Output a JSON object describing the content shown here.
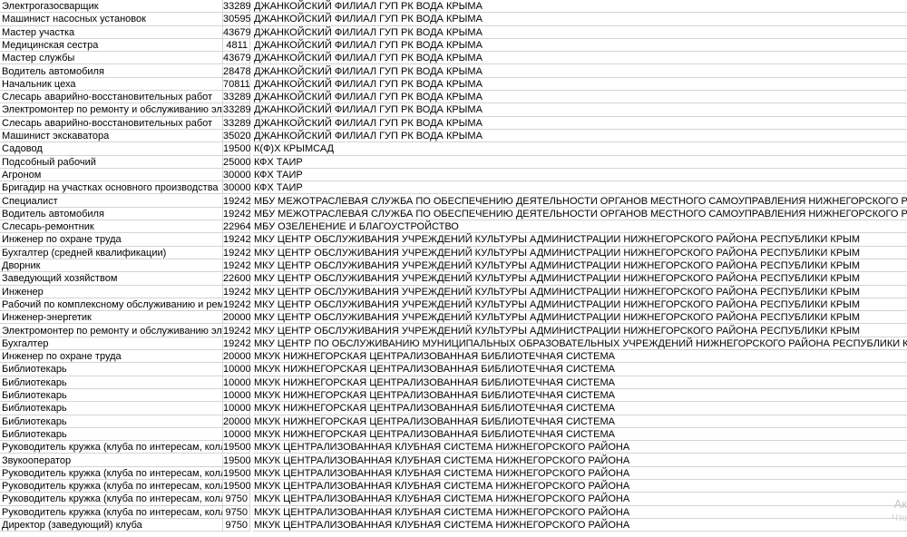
{
  "sheet": {
    "rows": [
      {
        "position": "Электрогазосварщик",
        "salary": "33289",
        "employer": "ДЖАНКОЙСКИЙ ФИЛИАЛ ГУП РК ВОДА КРЫМА"
      },
      {
        "position": "Машинист насосных установок",
        "salary": "30595",
        "employer": "ДЖАНКОЙСКИЙ ФИЛИАЛ ГУП РК ВОДА КРЫМА"
      },
      {
        "position": "Мастер участка",
        "salary": "43679",
        "employer": "ДЖАНКОЙСКИЙ ФИЛИАЛ ГУП РК ВОДА КРЫМА"
      },
      {
        "position": "Медицинская сестра",
        "salary": "4811",
        "employer": "ДЖАНКОЙСКИЙ ФИЛИАЛ ГУП РК ВОДА КРЫМА"
      },
      {
        "position": "Мастер службы",
        "salary": "43679",
        "employer": "ДЖАНКОЙСКИЙ ФИЛИАЛ ГУП РК ВОДА КРЫМА"
      },
      {
        "position": "Водитель автомобиля",
        "salary": "28478",
        "employer": "ДЖАНКОЙСКИЙ ФИЛИАЛ ГУП РК ВОДА КРЫМА"
      },
      {
        "position": "Начальник цеха",
        "salary": "70811",
        "employer": "ДЖАНКОЙСКИЙ ФИЛИАЛ ГУП РК ВОДА КРЫМА"
      },
      {
        "position": "Слесарь аварийно-восстановительных работ",
        "salary": "33289",
        "employer": "ДЖАНКОЙСКИЙ ФИЛИАЛ ГУП РК ВОДА КРЫМА"
      },
      {
        "position": "Электромонтер по ремонту и обслуживанию электрооборудования",
        "salary": "33289",
        "employer": "ДЖАНКОЙСКИЙ ФИЛИАЛ ГУП РК ВОДА КРЫМА"
      },
      {
        "position": "Слесарь аварийно-восстановительных работ",
        "salary": "33289",
        "employer": "ДЖАНКОЙСКИЙ ФИЛИАЛ ГУП РК ВОДА КРЫМА"
      },
      {
        "position": "Машинист экскаватора",
        "salary": "35020",
        "employer": "ДЖАНКОЙСКИЙ ФИЛИАЛ ГУП РК ВОДА КРЫМА"
      },
      {
        "position": "Садовод",
        "salary": "19500",
        "employer": "К(Ф)Х КРЫМСАД"
      },
      {
        "position": "Подсобный рабочий",
        "salary": "25000",
        "employer": "КФХ ТАИР"
      },
      {
        "position": "Агроном",
        "salary": "30000",
        "employer": "КФХ ТАИР"
      },
      {
        "position": "Бригадир на участках основного производства",
        "salary": "30000",
        "employer": "КФХ ТАИР"
      },
      {
        "position": "Специалист",
        "salary": "19242",
        "employer": "МБУ МЕЖОТРАСЛЕВАЯ СЛУЖБА ПО ОБЕСПЕЧЕНИЮ ДЕЯТЕЛЬНОСТИ ОРГАНОВ МЕСТНОГО САМОУПРАВЛЕНИЯ НИЖНЕГОРСКОГО РАЙОНА РЕСПУБЛИКИ КРЫМ"
      },
      {
        "position": "Водитель автомобиля",
        "salary": "19242",
        "employer": "МБУ МЕЖОТРАСЛЕВАЯ СЛУЖБА ПО ОБЕСПЕЧЕНИЮ ДЕЯТЕЛЬНОСТИ ОРГАНОВ МЕСТНОГО САМОУПРАВЛЕНИЯ НИЖНЕГОРСКОГО РАЙОНА РЕСПУБЛИКИ КРЫМ"
      },
      {
        "position": "Слесарь-ремонтник",
        "salary": "22964",
        "employer": "МБУ ОЗЕЛЕНЕНИЕ И БЛАГОУСТРОЙСТВО"
      },
      {
        "position": "Инженер по охране труда",
        "salary": "19242",
        "employer": "МКУ ЦЕНТР ОБСЛУЖИВАНИЯ УЧРЕЖДЕНИЙ КУЛЬТУРЫ АДМИНИСТРАЦИИ НИЖНЕГОРСКОГО РАЙОНА  РЕСПУБЛИКИ КРЫМ"
      },
      {
        "position": "Бухгалтер (средней квалификации)",
        "salary": "19242",
        "employer": "МКУ ЦЕНТР ОБСЛУЖИВАНИЯ УЧРЕЖДЕНИЙ КУЛЬТУРЫ АДМИНИСТРАЦИИ НИЖНЕГОРСКОГО РАЙОНА  РЕСПУБЛИКИ КРЫМ"
      },
      {
        "position": "Дворник",
        "salary": "19242",
        "employer": "МКУ ЦЕНТР ОБСЛУЖИВАНИЯ УЧРЕЖДЕНИЙ КУЛЬТУРЫ АДМИНИСТРАЦИИ НИЖНЕГОРСКОГО РАЙОНА  РЕСПУБЛИКИ КРЫМ"
      },
      {
        "position": "Заведующий хозяйством",
        "salary": "22600",
        "employer": "МКУ ЦЕНТР ОБСЛУЖИВАНИЯ УЧРЕЖДЕНИЙ КУЛЬТУРЫ АДМИНИСТРАЦИИ НИЖНЕГОРСКОГО РАЙОНА  РЕСПУБЛИКИ КРЫМ"
      },
      {
        "position": "Инженер",
        "salary": "19242",
        "employer": "МКУ ЦЕНТР ОБСЛУЖИВАНИЯ УЧРЕЖДЕНИЙ КУЛЬТУРЫ АДМИНИСТРАЦИИ НИЖНЕГОРСКОГО РАЙОНА  РЕСПУБЛИКИ КРЫМ"
      },
      {
        "position": "Рабочий по комплексному обслуживанию и ремонту зданий",
        "salary": "19242",
        "employer": "МКУ ЦЕНТР ОБСЛУЖИВАНИЯ УЧРЕЖДЕНИЙ КУЛЬТУРЫ АДМИНИСТРАЦИИ НИЖНЕГОРСКОГО РАЙОНА  РЕСПУБЛИКИ КРЫМ"
      },
      {
        "position": "Инженер-энергетик",
        "salary": "20000",
        "employer": "МКУ ЦЕНТР ОБСЛУЖИВАНИЯ УЧРЕЖДЕНИЙ КУЛЬТУРЫ АДМИНИСТРАЦИИ НИЖНЕГОРСКОГО РАЙОНА  РЕСПУБЛИКИ КРЫМ"
      },
      {
        "position": "Электромонтер по ремонту и обслуживанию электрооборудования",
        "salary": "19242",
        "employer": "МКУ ЦЕНТР ОБСЛУЖИВАНИЯ УЧРЕЖДЕНИЙ КУЛЬТУРЫ АДМИНИСТРАЦИИ НИЖНЕГОРСКОГО РАЙОНА  РЕСПУБЛИКИ КРЫМ"
      },
      {
        "position": "Бухгалтер",
        "salary": "19242",
        "employer": "МКУ ЦЕНТР ПО ОБСЛУЖИВАНИЮ МУНИЦИПАЛЬНЫХ ОБРАЗОВАТЕЛЬНЫХ УЧРЕЖДЕНИЙ НИЖНЕГОРСКОГО РАЙОНА РЕСПУБЛИКИ КРЫМ"
      },
      {
        "position": "Инженер по охране труда",
        "salary": "20000",
        "employer": "МКУК НИЖНЕГОРСКАЯ ЦЕНТРАЛИЗОВАННАЯ БИБЛИОТЕЧНАЯ СИСТЕМА"
      },
      {
        "position": "Библиотекарь",
        "salary": "10000",
        "employer": "МКУК НИЖНЕГОРСКАЯ ЦЕНТРАЛИЗОВАННАЯ БИБЛИОТЕЧНАЯ СИСТЕМА"
      },
      {
        "position": "Библиотекарь",
        "salary": "10000",
        "employer": "МКУК НИЖНЕГОРСКАЯ ЦЕНТРАЛИЗОВАННАЯ БИБЛИОТЕЧНАЯ СИСТЕМА"
      },
      {
        "position": "Библиотекарь",
        "salary": "10000",
        "employer": "МКУК НИЖНЕГОРСКАЯ ЦЕНТРАЛИЗОВАННАЯ БИБЛИОТЕЧНАЯ СИСТЕМА"
      },
      {
        "position": "Библиотекарь",
        "salary": "10000",
        "employer": "МКУК НИЖНЕГОРСКАЯ ЦЕНТРАЛИЗОВАННАЯ БИБЛИОТЕЧНАЯ СИСТЕМА"
      },
      {
        "position": "Библиотекарь",
        "salary": "20000",
        "employer": "МКУК НИЖНЕГОРСКАЯ ЦЕНТРАЛИЗОВАННАЯ БИБЛИОТЕЧНАЯ СИСТЕМА"
      },
      {
        "position": "Библиотекарь",
        "salary": "10000",
        "employer": "МКУК НИЖНЕГОРСКАЯ ЦЕНТРАЛИЗОВАННАЯ БИБЛИОТЕЧНАЯ СИСТЕМА"
      },
      {
        "position": "Руководитель кружка (клуба по интересам, коллектива)",
        "salary": "19500",
        "employer": "МКУК ЦЕНТРАЛИЗОВАННАЯ КЛУБНАЯ СИСТЕМА НИЖНЕГОРСКОГО РАЙОНА"
      },
      {
        "position": "Звукооператор",
        "salary": "19500",
        "employer": "МКУК ЦЕНТРАЛИЗОВАННАЯ КЛУБНАЯ СИСТЕМА НИЖНЕГОРСКОГО РАЙОНА"
      },
      {
        "position": "Руководитель кружка (клуба по интересам, коллектива)",
        "salary": "19500",
        "employer": "МКУК ЦЕНТРАЛИЗОВАННАЯ КЛУБНАЯ СИСТЕМА НИЖНЕГОРСКОГО РАЙОНА"
      },
      {
        "position": "Руководитель кружка (клуба по интересам, коллектива)",
        "salary": "19500",
        "employer": "МКУК ЦЕНТРАЛИЗОВАННАЯ КЛУБНАЯ СИСТЕМА НИЖНЕГОРСКОГО РАЙОНА"
      },
      {
        "position": "Руководитель кружка (клуба по интересам, коллектива)",
        "salary": "9750",
        "employer": "МКУК ЦЕНТРАЛИЗОВАННАЯ КЛУБНАЯ СИСТЕМА НИЖНЕГОРСКОГО РАЙОНА"
      },
      {
        "position": "Руководитель кружка (клуба по интересам, коллектива)",
        "salary": "9750",
        "employer": "МКУК ЦЕНТРАЛИЗОВАННАЯ КЛУБНАЯ СИСТЕМА НИЖНЕГОРСКОГО РАЙОНА"
      },
      {
        "position": "Директор (заведующий) клуба",
        "salary": "9750",
        "employer": "МКУК ЦЕНТРАЛИЗОВАННАЯ КЛУБНАЯ СИСТЕМА НИЖНЕГОРСКОГО РАЙОНА"
      }
    ]
  },
  "watermark": {
    "line1": "Ак",
    "line2": "Что"
  }
}
